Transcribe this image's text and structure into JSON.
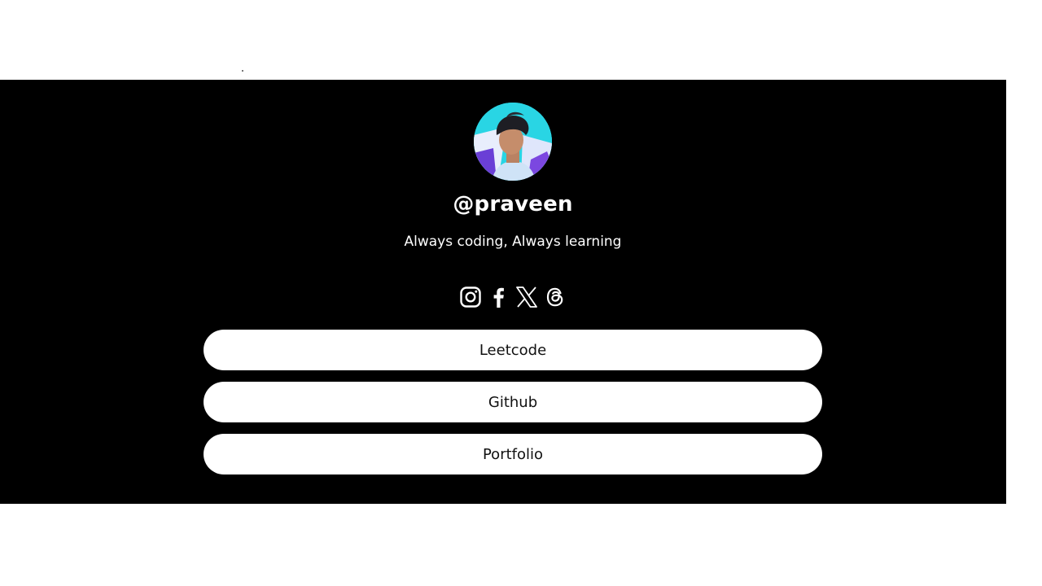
{
  "profile": {
    "handle": "@praveen",
    "bio": "Always coding, Always learning",
    "avatar_icon": "profile-photo"
  },
  "socials": [
    {
      "icon": "instagram-icon"
    },
    {
      "icon": "facebook-icon"
    },
    {
      "icon": "x-icon"
    },
    {
      "icon": "threads-icon"
    }
  ],
  "links": [
    {
      "label": "Leetcode"
    },
    {
      "label": "Github"
    },
    {
      "label": "Portfolio"
    }
  ],
  "colors": {
    "background": "#000000",
    "page": "#ffffff",
    "button_bg": "#ffffff",
    "button_text": "#111111",
    "avatar_accent": "#2fd8e6"
  }
}
